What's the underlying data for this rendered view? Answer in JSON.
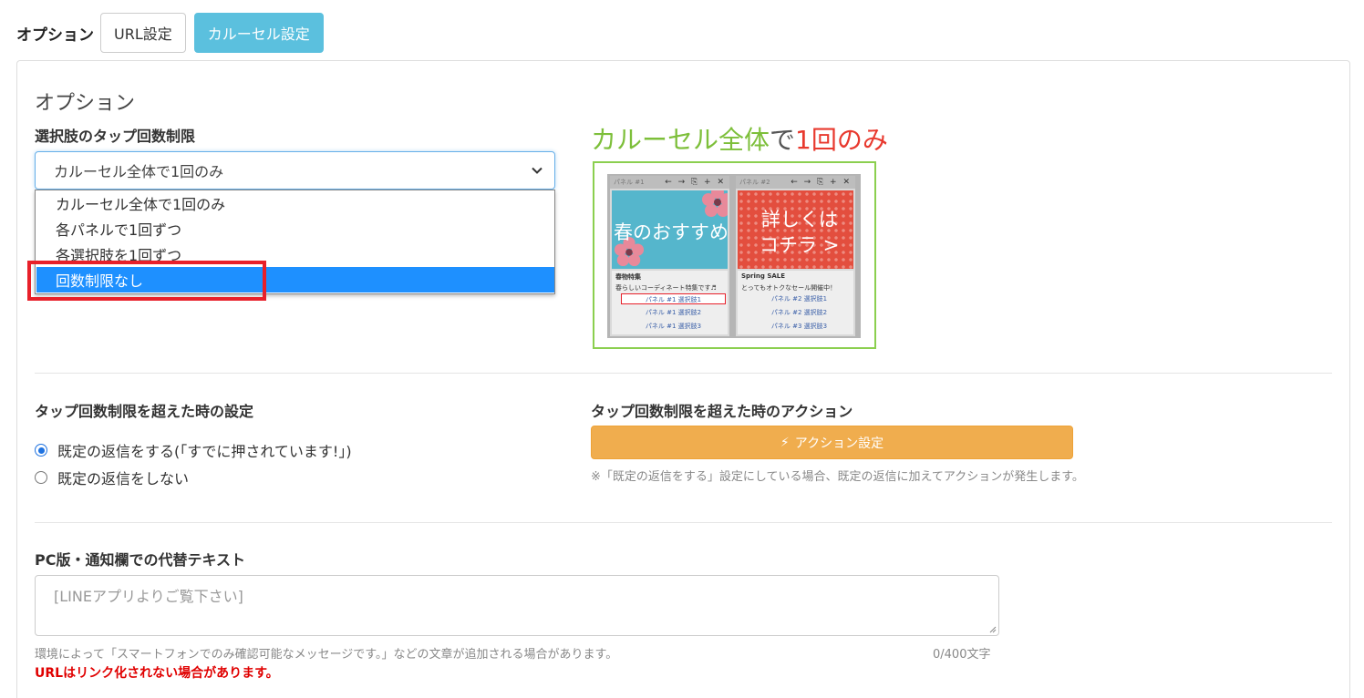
{
  "top_tabs": {
    "label": "オプション",
    "url_tab": "URL設定",
    "carousel_tab": "カルーセル設定"
  },
  "option": {
    "section_title": "オプション",
    "tap_limit_label": "選択肢のタップ回数制限",
    "select_value": "カルーセル全体で1回のみ",
    "dropdown_options": [
      "カルーセル全体で1回のみ",
      "各パネルで1回ずつ",
      "各選択肢を1回ずつ",
      "回数制限なし"
    ],
    "dropdown_selected_index": 3
  },
  "preview": {
    "title_part1": "カルーセル全体",
    "title_part2": "で",
    "title_part3": "1回のみ",
    "cards": [
      {
        "header": "パネル #1",
        "image_text": "春のおすすめ",
        "title": "春物特集",
        "desc": "春らしいコーディネート特集です♬",
        "options": [
          "パネル #1 選択肢1",
          "パネル #1 選択肢2",
          "パネル #1 選択肢3"
        ]
      },
      {
        "header": "パネル #2",
        "image_text_line1": "詳しくは",
        "image_text_line2": "コチラ >",
        "title": "Spring SALE",
        "desc": "とってもオトクなセール開催中！",
        "options": [
          "パネル #2 選択肢1",
          "パネル #2 選択肢2",
          "パネル #3 選択肢3"
        ]
      }
    ],
    "tools": "← → ⎘ + ✕"
  },
  "over_limit": {
    "setting_label": "タップ回数制限を超えた時の設定",
    "radio_reply": "既定の返信をする(「すでに押されています!」)",
    "radio_no_reply": "既定の返信をしない",
    "selected": "reply",
    "action_label": "タップ回数制限を超えた時のアクション",
    "action_button": "アクション設定",
    "action_note": "※「既定の返信をする」設定にしている場合、既定の返信に加えてアクションが発生します。"
  },
  "alt_text": {
    "label": "PC版・通知欄での代替テキスト",
    "placeholder": "[LINEアプリよりご覧下さい]",
    "help": "環境によって「スマートフォンでのみ確認可能なメッセージです。」などの文章が追加される場合があります。",
    "counter": "0/400文字",
    "warning": "URLはリンク化されない場合があります。"
  },
  "colors": {
    "info_tab": "#5bc0de",
    "warning_button": "#f0ad4e",
    "dropdown_highlight": "#1e90ff",
    "annotation_red": "#e8202a",
    "preview_green": "#7dbf3a",
    "preview_red": "#e8392e"
  }
}
